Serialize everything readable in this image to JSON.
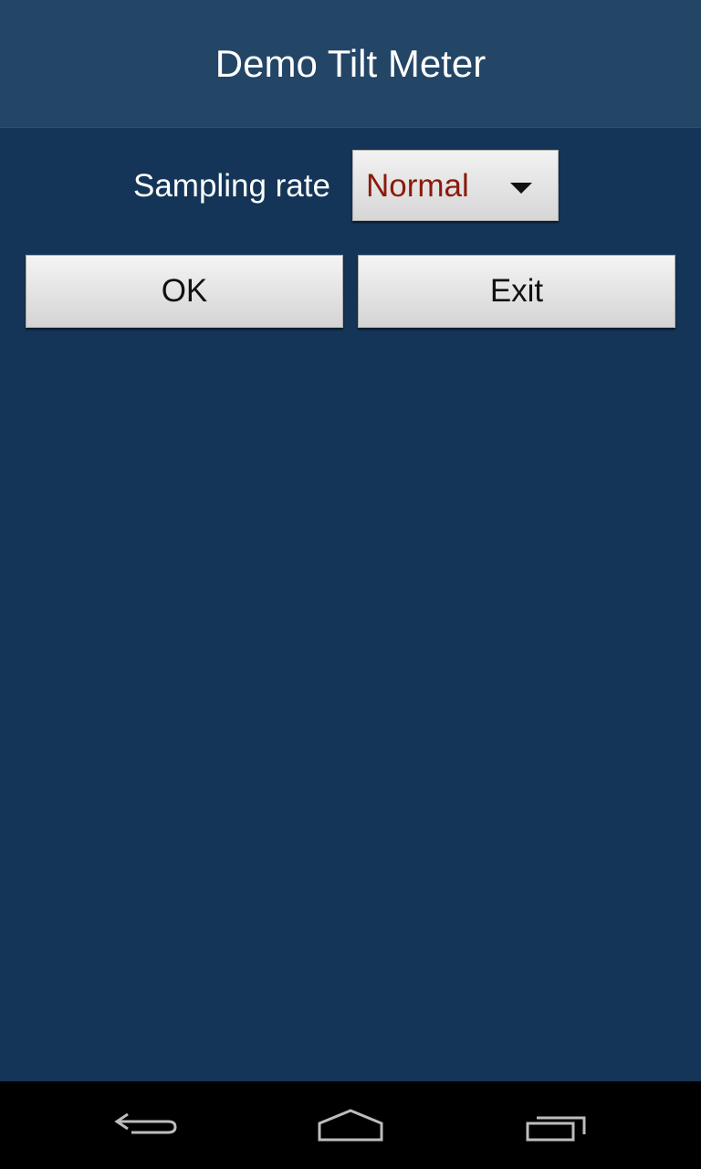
{
  "app": {
    "title": "Demo Tilt Meter"
  },
  "form": {
    "sampling_label": "Sampling rate",
    "sampling_value": "Normal",
    "ok_label": "OK",
    "exit_label": "Exit"
  },
  "navbar": {
    "back_icon": "back-arrow-icon",
    "home_icon": "home-icon",
    "recent_icon": "recent-apps-icon"
  },
  "colors": {
    "background": "#143557",
    "titlebar": "#234566",
    "spinner_value_text": "#8b1a0c"
  }
}
